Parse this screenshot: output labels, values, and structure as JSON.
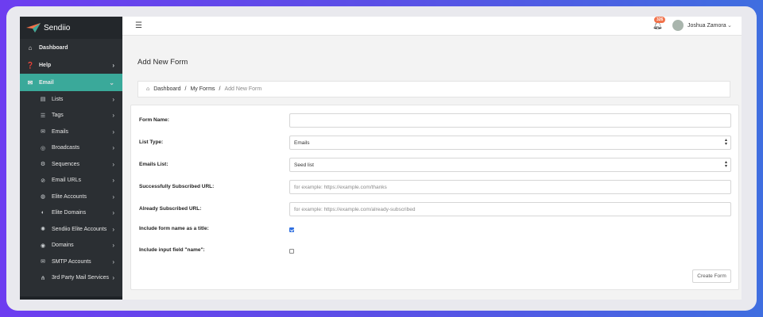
{
  "brand": {
    "name": "Sendiio",
    "accent": "#3aa99a"
  },
  "sidebar": {
    "top_items": [
      {
        "label": "Dashboard",
        "icon": "home-icon"
      },
      {
        "label": "Help",
        "icon": "question-circle-icon"
      },
      {
        "label": "Email",
        "icon": "envelope-icon",
        "active": true
      }
    ],
    "sub_items": [
      {
        "label": "Lists",
        "icon": "list-box-icon"
      },
      {
        "label": "Tags",
        "icon": "tag-list-icon"
      },
      {
        "label": "Emails",
        "icon": "mail-icon"
      },
      {
        "label": "Broadcasts",
        "icon": "broadcast-icon"
      },
      {
        "label": "Sequences",
        "icon": "gear-icon"
      },
      {
        "label": "Email URLs",
        "icon": "link-icon"
      },
      {
        "label": "Elite Accounts",
        "icon": "globe-icon"
      },
      {
        "label": "Elite Domains",
        "icon": "globe-alt-icon"
      },
      {
        "label": "Sendiio Elite Accounts",
        "icon": "settings-icon"
      },
      {
        "label": "Domains",
        "icon": "domain-icon"
      },
      {
        "label": "SMTP Accounts",
        "icon": "smtp-mail-icon"
      },
      {
        "label": "3rd Party Mail Services",
        "icon": "sitemap-icon"
      }
    ]
  },
  "topbar": {
    "notification_count": "326",
    "user_name": "Joshua Zamora"
  },
  "page": {
    "title": "Add New Form",
    "breadcrumb": {
      "home": "Dashboard",
      "sep": "/",
      "parent": "My Forms",
      "current": "Add New Form"
    }
  },
  "form": {
    "form_name_label": "Form Name:",
    "form_name_value": "",
    "list_type_label": "List Type:",
    "list_type_value": "Emails",
    "emails_list_label": "Emails List:",
    "emails_list_value": "Seed list",
    "success_url_label": "Successfully Subscribed URL:",
    "success_url_placeholder": "for example: https://example.com/thanks",
    "already_url_label": "Already Subscribed URL:",
    "already_url_placeholder": "for example: https://example.com/already-subscribed",
    "include_title_label": "Include form name as a title:",
    "include_title_checked": true,
    "include_name_label": "Include input field \"name\":",
    "include_name_checked": false,
    "submit_label": "Create Form"
  }
}
